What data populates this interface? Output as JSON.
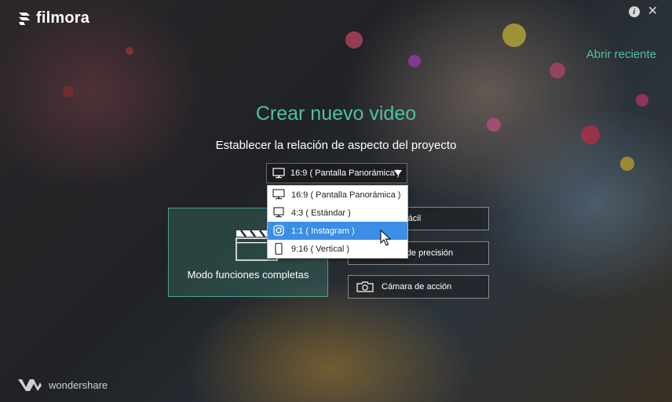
{
  "app": {
    "logo_text": "filmora",
    "brand_text": "wondershare"
  },
  "header": {
    "recent_link": "Abrir reciente"
  },
  "main": {
    "title": "Crear nuevo video",
    "subtitle": "Establecer la relación de aspecto del proyecto",
    "aspect_selected": "16:9 ( Pantalla Panorámica )"
  },
  "aspect_options": [
    {
      "label": "16:9 ( Pantalla Panorámica )",
      "icon": "monitor-icon"
    },
    {
      "label": "4:3 ( Estándar )",
      "icon": "monitor-icon"
    },
    {
      "label": "1:1 ( Instagram )",
      "icon": "instagram-icon"
    },
    {
      "label": "9:16 ( Vertical )",
      "icon": "phone-icon"
    }
  ],
  "modes": {
    "full_label": "Modo funciones completas",
    "easy_label": "Modo fácil",
    "precision_label": "Editor de precisión",
    "action_label": "Cámara de acción"
  },
  "colors": {
    "accent": "#4fc1a6",
    "highlight": "#3a8ee6"
  }
}
